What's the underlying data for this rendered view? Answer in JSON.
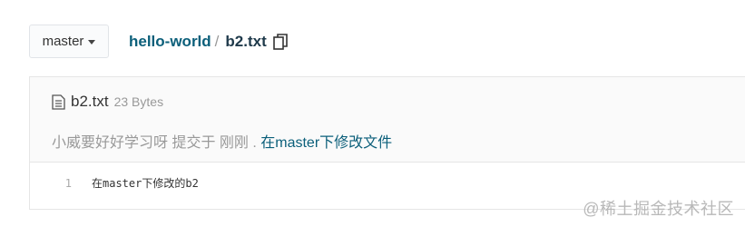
{
  "branch": {
    "label": "master"
  },
  "breadcrumb": {
    "repo": "hello-world",
    "separator": "/",
    "file": "b2.txt"
  },
  "file": {
    "name": "b2.txt",
    "size": "23 Bytes",
    "commit_author": "小威要好好学习呀",
    "commit_action": " 提交于 刚刚 . ",
    "commit_message": "在master下修改文件"
  },
  "code": {
    "lines": [
      {
        "number": "1",
        "text": "在master下修改的b2"
      }
    ]
  },
  "watermark": "@稀土掘金技术社区"
}
